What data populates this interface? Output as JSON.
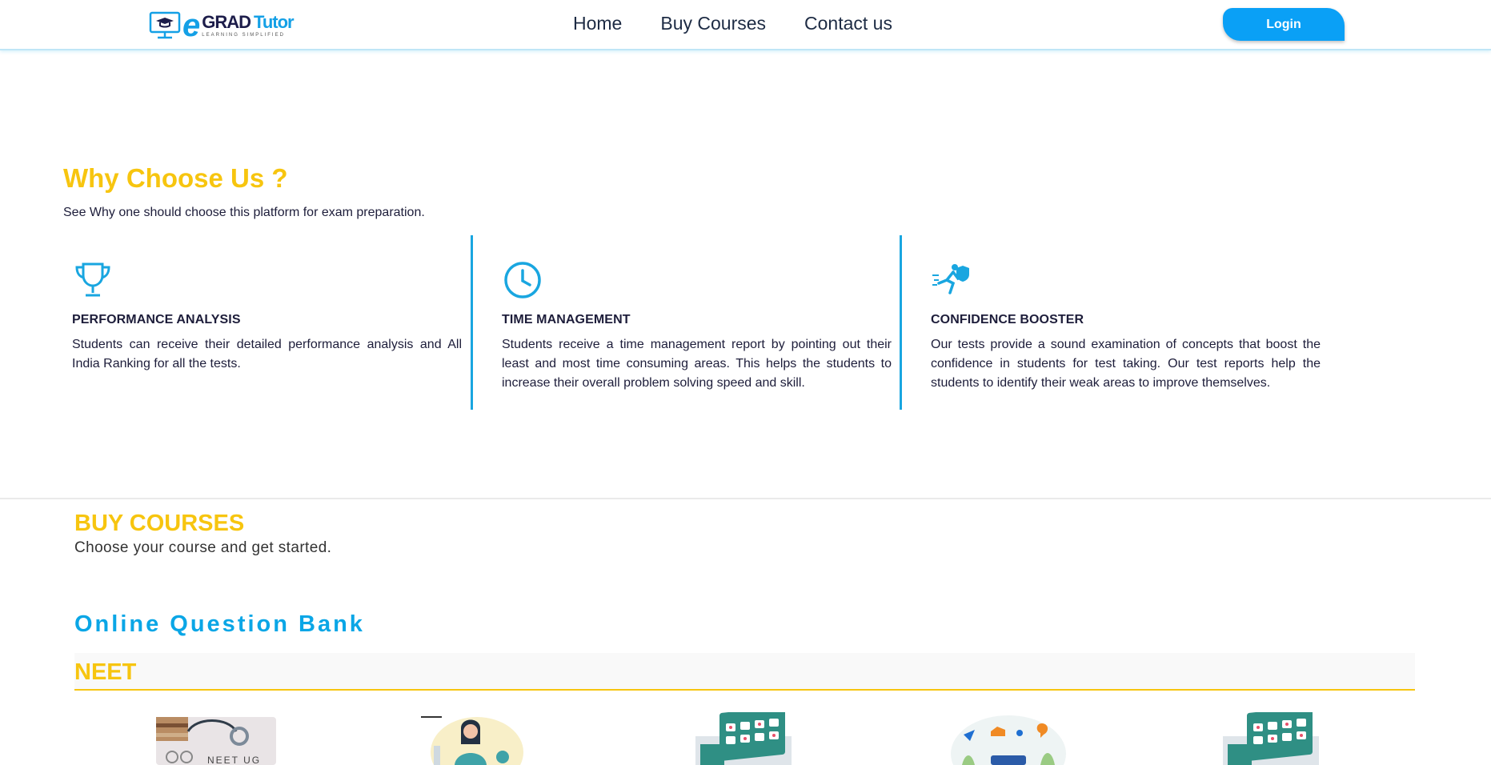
{
  "header": {
    "logo": {
      "e": "e",
      "grad": "GRAD",
      "tutor": "Tutor",
      "tagline": "LEARNING SIMPLIFIED"
    },
    "nav": [
      "Home",
      "Buy Courses",
      "Contact us"
    ],
    "login_label": "Login"
  },
  "why": {
    "title": "Why Choose Us ?",
    "subtitle": "See Why one should choose this platform for exam preparation.",
    "features": [
      {
        "icon": "trophy-icon",
        "title": "PERFORMANCE ANALYSIS",
        "text": "Students can receive their detailed performance analysis and All India Ranking for all the tests."
      },
      {
        "icon": "clock-icon",
        "title": "TIME MANAGEMENT",
        "text": "Students receive a time management report by pointing out their least and most time consuming areas. This helps the students to increase their overall problem solving speed and skill."
      },
      {
        "icon": "runner-shield-icon",
        "title": "CONFIDENCE BOOSTER",
        "text": "Our tests provide a sound examination of concepts that boost the confidence in students for test taking. Our test reports help the students to identify their weak areas to improve themselves."
      }
    ]
  },
  "buy": {
    "title": "BUY COURSES",
    "subtitle": "Choose your course and get started.",
    "section_title": "Online Question Bank",
    "category": "NEET",
    "cards": [
      {
        "name": "course-card-neet-ug",
        "label": "NEET UG"
      },
      {
        "name": "course-card-2"
      },
      {
        "name": "course-card-3"
      },
      {
        "name": "course-card-4"
      },
      {
        "name": "course-card-5"
      }
    ]
  },
  "colors": {
    "accent_yellow": "#f7c50f",
    "accent_blue": "#0aa0f6",
    "divider_blue": "#19a6e0"
  }
}
